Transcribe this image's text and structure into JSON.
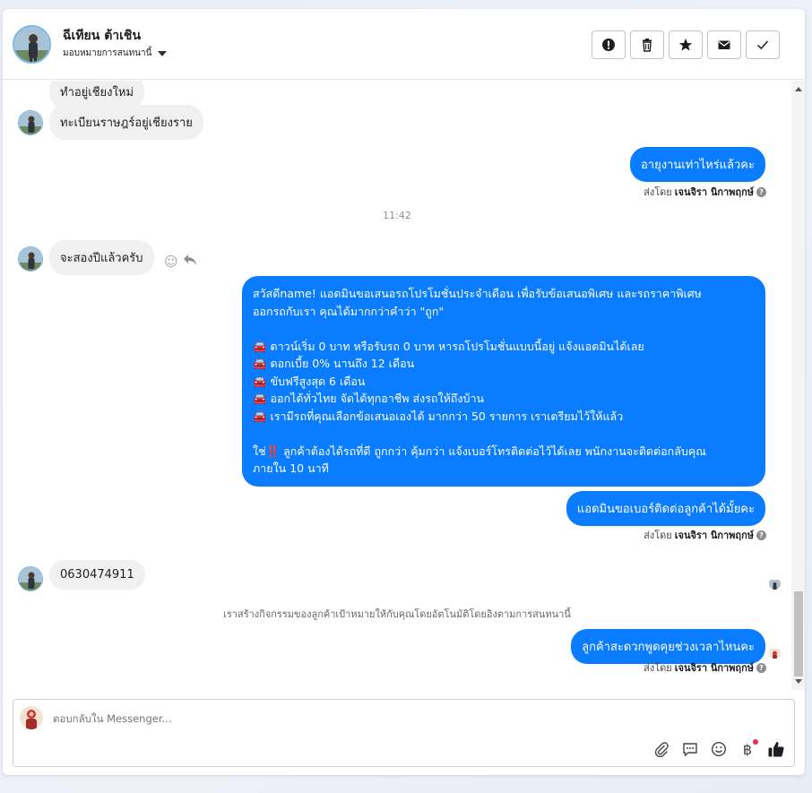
{
  "contact": {
    "name": "ฉีเทียน ต้าเชิน",
    "assign_label": "มอบหมายการสนทนานี้"
  },
  "header_actions": [
    {
      "icon": "alert-icon"
    },
    {
      "icon": "trash-icon"
    },
    {
      "icon": "star-icon"
    },
    {
      "icon": "mail-icon"
    },
    {
      "icon": "check-icon"
    }
  ],
  "messages": {
    "m1": "ทำอยู่เชียงใหม่",
    "m2": "ทะเบียนราษฎร์อยู่เชียงราย",
    "m3": "อายุงานเท่าไหร่แล้วคะ",
    "m3_sentby_prefix": "ส่งโดย",
    "m3_sentby_name": "เจนจิรา นิกาพฤกษ์",
    "time1": "11:42",
    "m4": "จะสองปีแล้วครับ",
    "promo_lines": [
      "สวัสดีname! แอดมินขอเสนอรถโปรโมชั่นประจำเดือน เพื่อรับข้อเสนอพิเศษ และรถราคาพิเศษ",
      "ออกรถกับเรา คุณได้มากกว่าคำว่า \"ถูก\"",
      "",
      "🚘 ดาวน์เริ่ม 0 บาท หรือรับรถ 0 บาท หารถโปรโมชั่นแบบนี้อยู่ แจ้งแอดมินได้เลย",
      "🚘 ดอกเบี้ย 0% นานถึง 12 เดือน",
      "🚘 ขับฟรีสูงสุด 6 เดือน",
      "🚘 ออกได้ทั่วไทย จัดได้ทุกอาชีพ ส่งรถให้ถึงบ้าน",
      "🚘 เรามีรถที่คุณเลือกข้อเสนอเองได้ มากกว่า 50 รายการ เราเตรียมไว้ให้แล้ว",
      "",
      "ใช่‼️ ลูกค้าต้องได้รถที่ดี ถูกกว่า คุ้มกว่า แจ้งเบอร์โทรติดต่อไว้ได้เลย พนักงานจะติดต่อกลับคุณ",
      "ภายใน 10 นาที"
    ],
    "m6": "แอดมินขอเบอร์ติดต่อลูกค้าได้มั้ยคะ",
    "m6_sentby_prefix": "ส่งโดย",
    "m6_sentby_name": "เจนจิรา นิกาพฤกษ์",
    "m7": "0630474911",
    "system": "เราสร้างกิจกรรมของลูกค้าเป้าหมายให้กับคุณโดยอัตโนมัติโดยอิงตามการสนทนานี้",
    "m8": "ลูกค้าสะดวกพูดคุยช่วงเวลาไหนคะ",
    "m8_sentby_prefix": "ส่งโดย",
    "m8_sentby_name": "เจนจิรา นิกาพฤกษ์"
  },
  "composer": {
    "placeholder": "ตอบกลับใน Messenger...",
    "tools": [
      "attach-icon",
      "saved-reply-icon",
      "emoji-icon",
      "baht-icon",
      "like-icon"
    ]
  },
  "colors": {
    "outgoing_bubble": "#0a7cff",
    "incoming_bubble": "#f0f0f0"
  }
}
